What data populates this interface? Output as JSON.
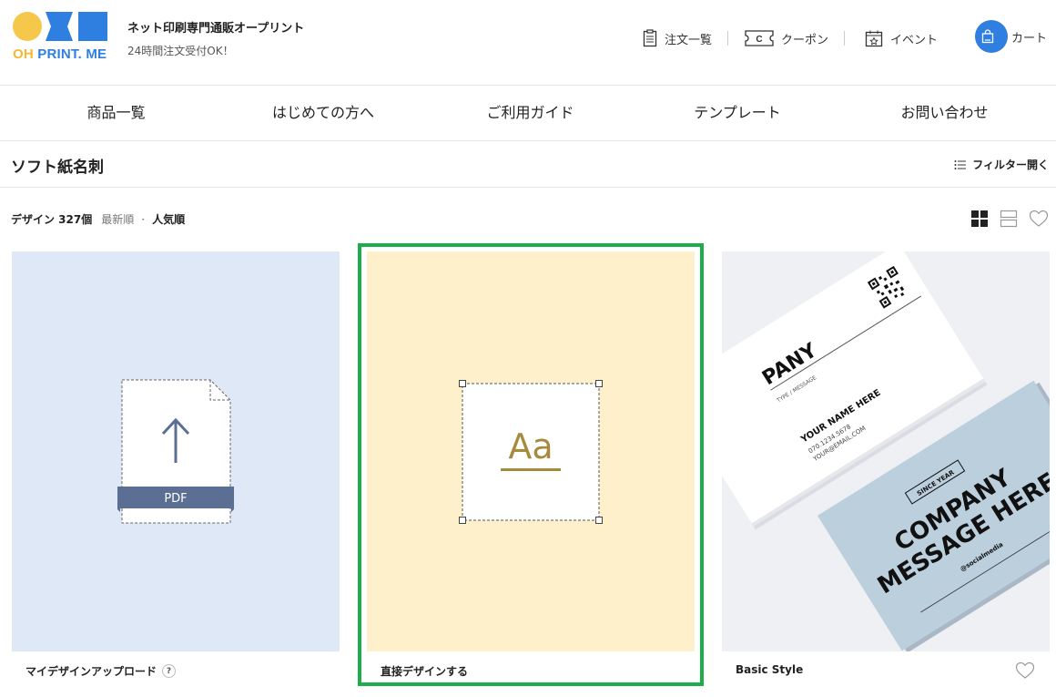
{
  "brand": {
    "logo_oh": "OH",
    "logo_rest": "PRINT. ME",
    "title": "ネット印刷専門通販オープリント",
    "subtitle": "24時間注文受付OK！"
  },
  "utility": {
    "orders": "注文一覧",
    "coupon": "クーポン",
    "event": "イベント",
    "cart": "カート"
  },
  "nav": [
    "商品一覧",
    "はじめての方へ",
    "ご利用ガイド",
    "テンプレート",
    "お問い合わせ"
  ],
  "category": {
    "title": "ソフト紙名刺",
    "filter": "フィルター開く"
  },
  "sort": {
    "count": "デザイン 327個",
    "newest": "最新順",
    "popular": "人気順"
  },
  "cards": [
    {
      "label": "マイデザインアップロード",
      "badge": "?",
      "pdf": "PDF"
    },
    {
      "label": "直接デザインする",
      "glyph": "Aa"
    },
    {
      "label": "Basic Style"
    }
  ],
  "businesscard": {
    "front_company": "PANY",
    "front_sub": "TYPE / MESSAGE",
    "front_name": "YOUR NAME HERE",
    "front_phone": "070.1234.5678",
    "front_email": "YOUR@EMAIL.COM",
    "back_since": "SINCE YEAR",
    "back_company": "COMPANY",
    "back_message": "MESSAGE HERE",
    "back_social": "@socialmedia"
  },
  "colors": {
    "accent_blue": "#2f7fe0",
    "logo_yellow": "#f5b82e",
    "highlight_green": "#1fad4b",
    "card1_bg": "#dfe8f6",
    "card2_bg": "#fff0cc",
    "card3_bg": "#eef0f4"
  }
}
